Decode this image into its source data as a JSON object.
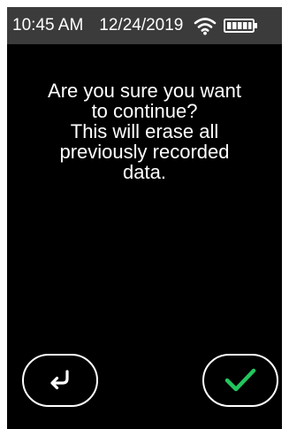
{
  "status_bar": {
    "time": "10:45 AM",
    "date": "12/24/2019",
    "wifi_icon": "wifi-icon",
    "battery_icon": "battery-full-icon"
  },
  "dialog": {
    "lines": [
      "Are you sure you want",
      "to continue?",
      "This will erase all",
      "previously recorded",
      "data."
    ]
  },
  "buttons": {
    "back": {
      "icon": "return-arrow-icon"
    },
    "confirm": {
      "icon": "checkmark-icon"
    }
  },
  "colors": {
    "background": "#000000",
    "status_bar": "#3b3b3b",
    "text": "#ffffff",
    "confirm_accent": "#22c55e"
  }
}
